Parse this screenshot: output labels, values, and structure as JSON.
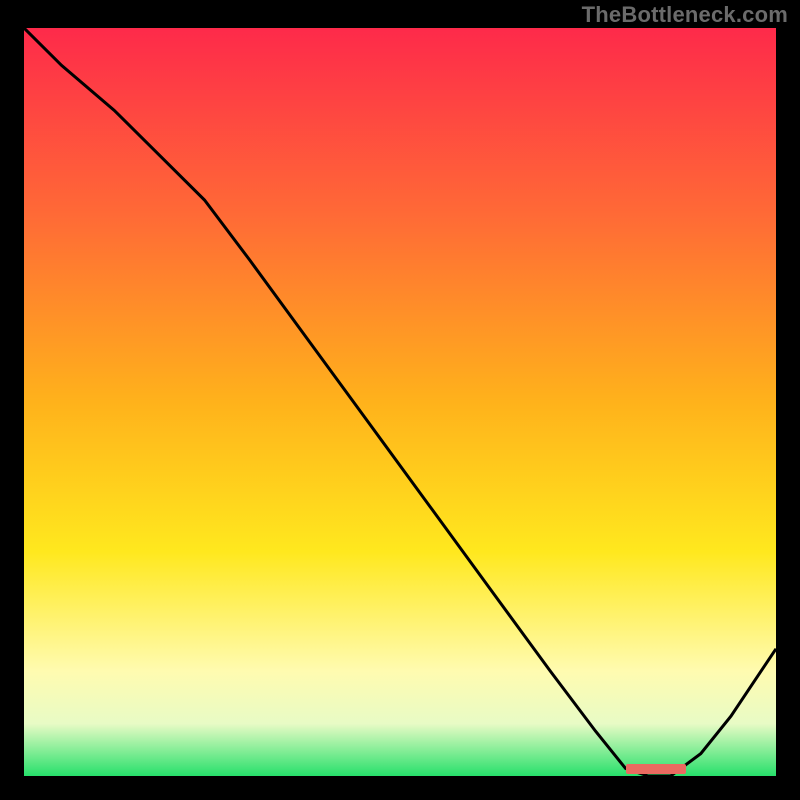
{
  "attribution": "TheBottleneck.com",
  "colors": {
    "bg": "#000000",
    "grad_top": "#fe2a4a",
    "grad_mid1": "#ff6a36",
    "grad_mid2": "#ffb21b",
    "grad_mid3": "#ffe81e",
    "grad_low1": "#fffbb0",
    "grad_low2": "#e8fbc5",
    "grad_bottom": "#27e06b",
    "line": "#000000",
    "marker": "#ea6a60"
  },
  "chart_data": {
    "type": "line",
    "title": "",
    "xlabel": "",
    "ylabel": "",
    "xlim": [
      0,
      100
    ],
    "ylim": [
      0,
      100
    ],
    "x": [
      0,
      5,
      12,
      18,
      24,
      30,
      38,
      46,
      54,
      62,
      70,
      76,
      80,
      83,
      86,
      90,
      94,
      100
    ],
    "y": [
      100,
      95,
      89,
      83,
      77,
      69,
      58,
      47,
      36,
      25,
      14,
      6,
      1,
      0,
      0,
      3,
      8,
      17
    ],
    "optimum_band": {
      "x_start": 80,
      "x_end": 88,
      "y": 0
    },
    "grid": false,
    "legend": false
  }
}
